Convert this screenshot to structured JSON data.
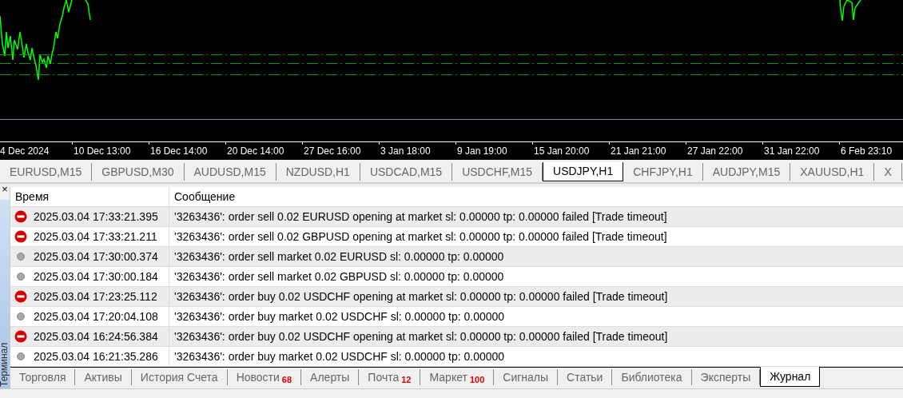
{
  "chart": {
    "time_axis": [
      "4 Dec 2024",
      "10 Dec 13:00",
      "16 Dec 14:00",
      "20 Dec 14:00",
      "27 Dec 16:00",
      "3 Jan 18:00",
      "9 Jan 19:00",
      "15 Jan 20:00",
      "21 Jan 21:00",
      "27 Jan 22:00",
      "31 Jan 22:00",
      "6 Feb 23:10"
    ]
  },
  "chart_tabs": [
    {
      "label": "EURUSD,M15",
      "selected": false
    },
    {
      "label": "GBPUSD,M30",
      "selected": false
    },
    {
      "label": "AUDUSD,M15",
      "selected": false
    },
    {
      "label": "NZDUSD,H1",
      "selected": false
    },
    {
      "label": "USDCAD,M15",
      "selected": false
    },
    {
      "label": "USDCHF,M15",
      "selected": false
    },
    {
      "label": "USDJPY,H1",
      "selected": true
    },
    {
      "label": "CHFJPY,H1",
      "selected": false
    },
    {
      "label": "AUDJPY,M15",
      "selected": false
    },
    {
      "label": "XAUUSD,H1",
      "selected": false
    },
    {
      "label": "X",
      "selected": false
    }
  ],
  "terminal": {
    "title": "Терминал",
    "close": "×",
    "columns": [
      "Время",
      "Сообщение"
    ],
    "rows": [
      {
        "kind": "error",
        "time": "2025.03.04 17:33:21.395",
        "message": "'3263436': order sell 0.02 EURUSD opening at market sl: 0.00000 tp: 0.00000 failed [Trade timeout]"
      },
      {
        "kind": "error",
        "time": "2025.03.04 17:33:21.211",
        "message": "'3263436': order sell 0.02 GBPUSD opening at market sl: 0.00000 tp: 0.00000 failed [Trade timeout]"
      },
      {
        "kind": "info",
        "time": "2025.03.04 17:30:00.374",
        "message": "'3263436': order sell market 0.02 EURUSD sl: 0.00000 tp: 0.00000"
      },
      {
        "kind": "info",
        "time": "2025.03.04 17:30:00.184",
        "message": "'3263436': order sell market 0.02 GBPUSD sl: 0.00000 tp: 0.00000"
      },
      {
        "kind": "error",
        "time": "2025.03.04 17:23:25.112",
        "message": "'3263436': order buy 0.02 USDCHF opening at market sl: 0.00000 tp: 0.00000 failed [Trade timeout]"
      },
      {
        "kind": "info",
        "time": "2025.03.04 17:20:04.108",
        "message": "'3263436': order buy market 0.02 USDCHF sl: 0.00000 tp: 0.00000"
      },
      {
        "kind": "error",
        "time": "2025.03.04 16:24:56.384",
        "message": "'3263436': order buy 0.02 USDCHF opening at market sl: 0.00000 tp: 0.00000 failed [Trade timeout]"
      },
      {
        "kind": "info",
        "time": "2025.03.04 16:21:35.286",
        "message": "'3263436': order buy market 0.02 USDCHF sl: 0.00000 tp: 0.00000"
      }
    ],
    "tabs": [
      {
        "label": "Торговля",
        "selected": false
      },
      {
        "label": "Активы",
        "selected": false
      },
      {
        "label": "История Счета",
        "selected": false
      },
      {
        "label": "Новости",
        "count": "68",
        "selected": false
      },
      {
        "label": "Алерты",
        "selected": false
      },
      {
        "label": "Почта",
        "count": "12",
        "selected": false
      },
      {
        "label": "Маркет",
        "count": "100",
        "selected": false
      },
      {
        "label": "Сигналы",
        "selected": false
      },
      {
        "label": "Статьи",
        "selected": false
      },
      {
        "label": "Библиотека",
        "selected": false
      },
      {
        "label": "Эксперты",
        "selected": false
      },
      {
        "label": "Журнал",
        "selected": true
      }
    ]
  }
}
